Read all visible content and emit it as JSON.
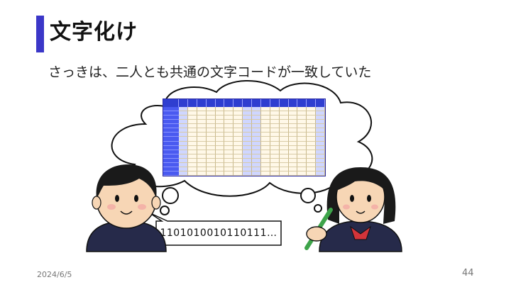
{
  "slide": {
    "title": "文字化け",
    "subtitle": "さっきは、二人とも共通の文字コードが一致していた",
    "speech_bubble_text": "1101010010110111…",
    "date": "2024/6/5",
    "page_number": "44"
  },
  "colors": {
    "accent_bar": "#3b37c8",
    "table_header": "#2f3ed0"
  },
  "icons": [
    "thought-cloud",
    "boy-student-illustration",
    "girl-student-writing-illustration",
    "character-code-table-image"
  ]
}
